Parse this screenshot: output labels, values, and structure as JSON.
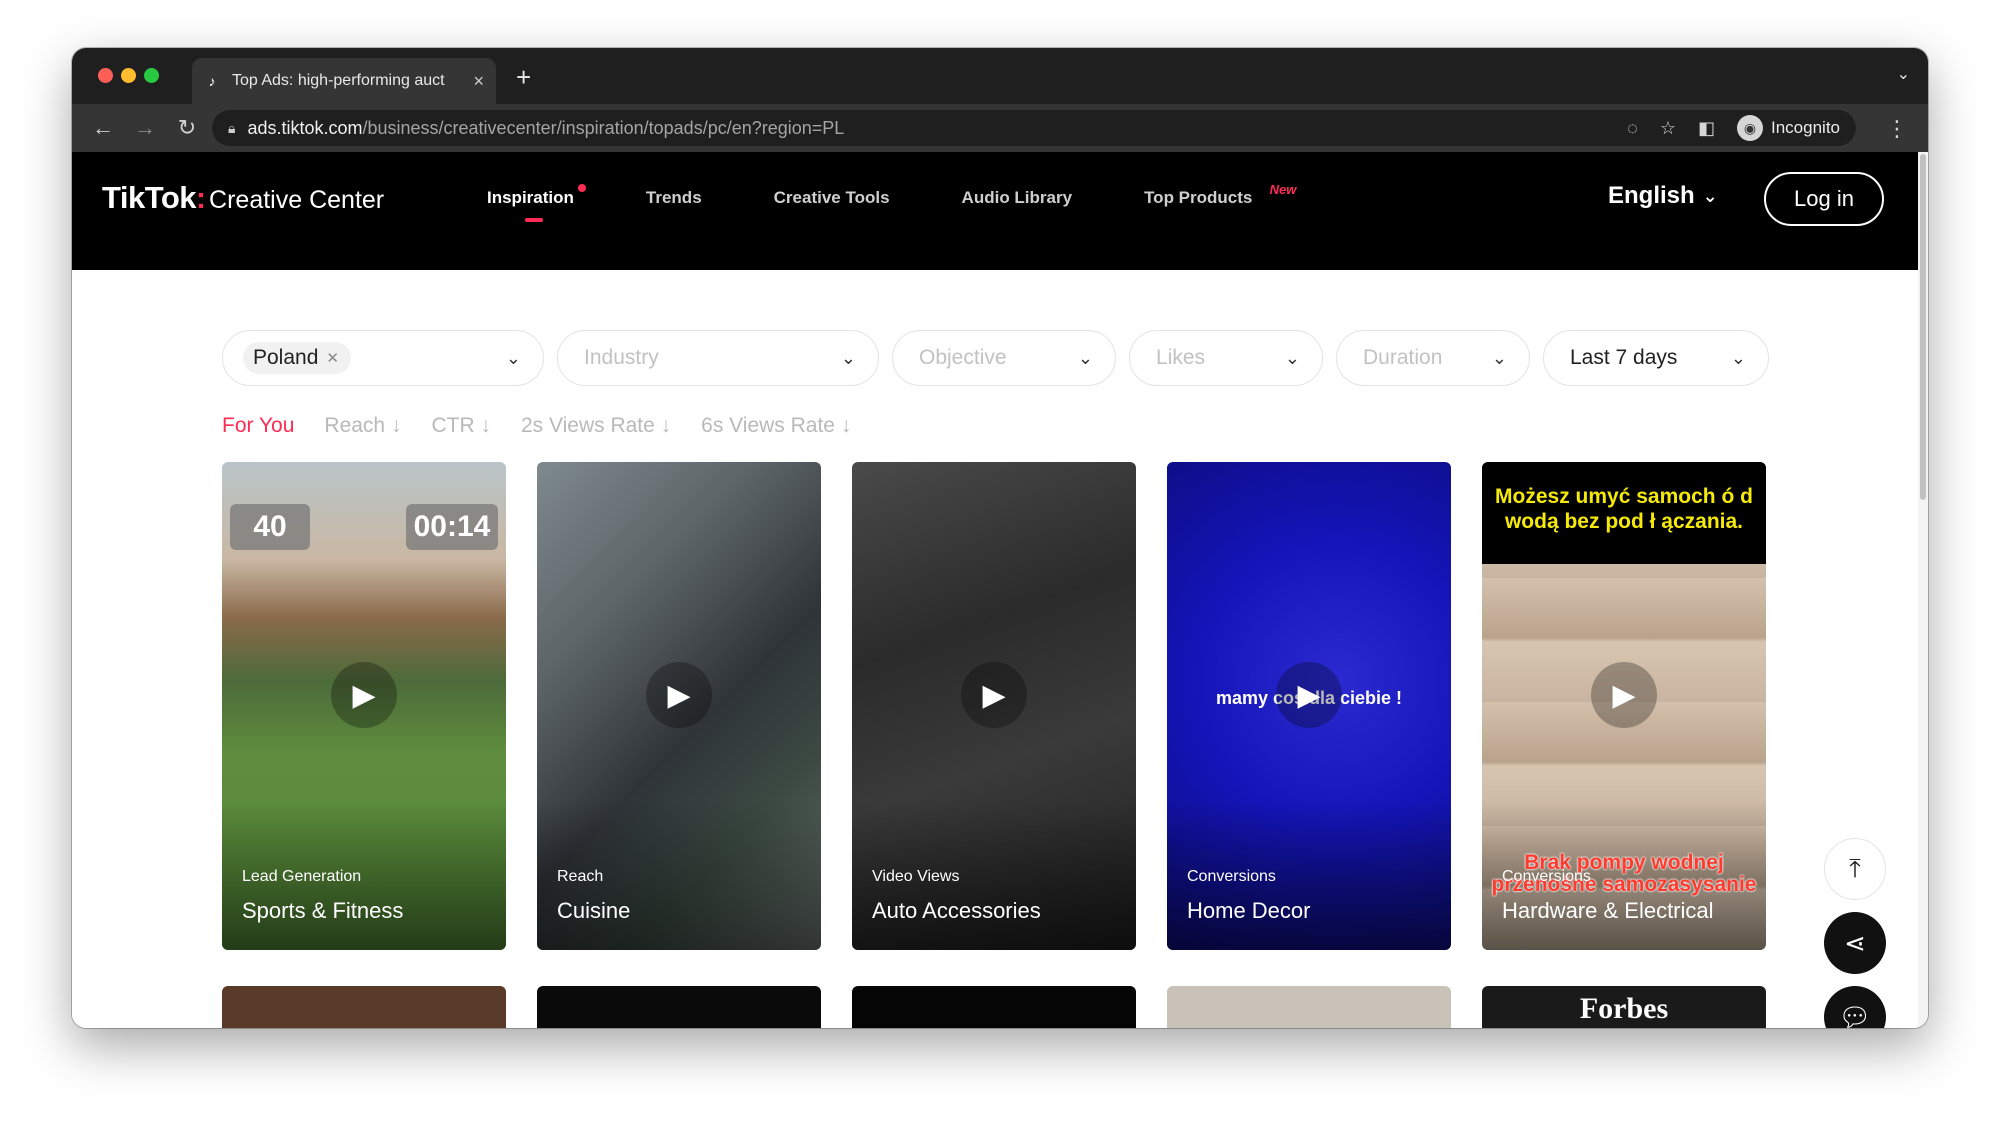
{
  "browser": {
    "tab_title": "Top Ads: high-performing auct",
    "tab_close": "×",
    "new_tab": "+",
    "url_host": "ads.tiktok.com",
    "url_path": "/business/creativecenter/inspiration/topads/pc/en?region=PL",
    "profile_label": "Incognito"
  },
  "site": {
    "logo_brand": "TikTok",
    "logo_product": "Creative Center",
    "nav": [
      {
        "label": "Inspiration"
      },
      {
        "label": "Trends"
      },
      {
        "label": "Creative Tools"
      },
      {
        "label": "Audio Library"
      },
      {
        "label": "Top Products",
        "badge": "New"
      }
    ],
    "language": "English",
    "login_label": "Log in"
  },
  "filters": {
    "country_chip": "Poland",
    "industry_placeholder": "Industry",
    "objective_placeholder": "Objective",
    "likes_placeholder": "Likes",
    "duration_placeholder": "Duration",
    "period": "Last 7 days"
  },
  "sorts": [
    "For You",
    "Reach ↓",
    "CTR ↓",
    "2s Views Rate ↓",
    "6s Views Rate ↓"
  ],
  "cards": [
    {
      "objective": "Lead Generation",
      "industry": "Sports & Fitness",
      "badge_left": "40",
      "badge_right": "00:14"
    },
    {
      "objective": "Reach",
      "industry": "Cuisine"
    },
    {
      "objective": "Video Views",
      "industry": "Auto Accessories"
    },
    {
      "objective": "Conversions",
      "industry": "Home Decor",
      "overlay": "mamy coś dla ciebie !"
    },
    {
      "objective": "Conversions",
      "industry": "Hardware & Electrical",
      "caption_top": "Możesz umyć samoch ó d wodą bez pod ł ączania.",
      "caption_bottom": "Brak pompy wodnej przenośne samozasysanie"
    }
  ],
  "row2_text": "Forbes",
  "colors": {
    "accent": "#fe2c55",
    "header_bg": "#000000",
    "browser_chrome": "#353535"
  }
}
